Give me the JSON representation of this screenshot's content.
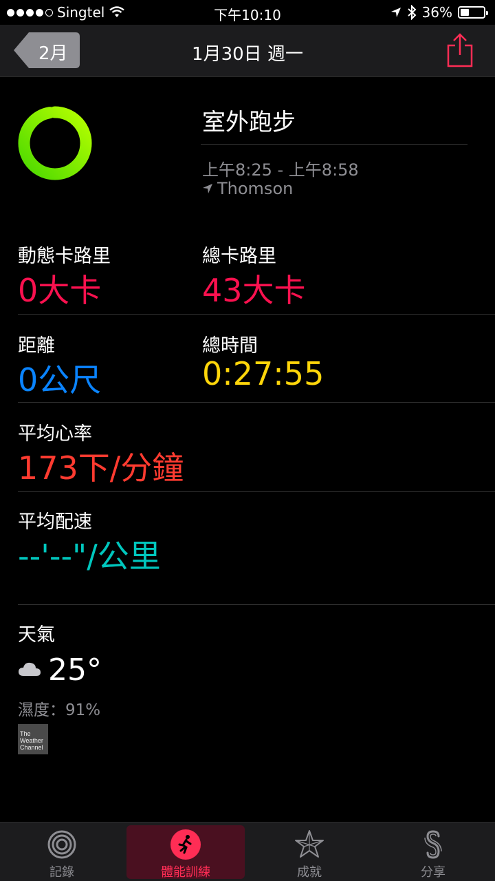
{
  "status_bar": {
    "carrier": "Singtel",
    "time": "下午10:10",
    "battery": "36%",
    "battery_level": 0.36
  },
  "nav": {
    "back_label": "2月",
    "title": "1月30日 週一"
  },
  "workout": {
    "title": "室外跑步",
    "time_range": "上午8:25 - 上午8:58",
    "location": "Thomson",
    "ring_progress": 0.97
  },
  "metrics": {
    "active_calories": {
      "label": "動態卡路里",
      "value": "0大卡"
    },
    "total_calories": {
      "label": "總卡路里",
      "value": "43大卡"
    },
    "distance": {
      "label": "距離",
      "value": "0公尺"
    },
    "total_time": {
      "label": "總時間",
      "value": "0:27:55"
    },
    "avg_heart_rate": {
      "label": "平均心率",
      "value": "173下/分鐘"
    },
    "avg_pace": {
      "label": "平均配速",
      "value": "--'--\"/公里"
    }
  },
  "weather": {
    "title": "天氣",
    "temperature": "25°",
    "humidity": "濕度：91%",
    "provider_logo": "The Weather Channel"
  },
  "tabs": [
    {
      "label": "記錄",
      "icon": "activity-rings-icon",
      "active": false
    },
    {
      "label": "體能訓練",
      "icon": "running-figure-icon",
      "active": true
    },
    {
      "label": "成就",
      "icon": "star-icon",
      "active": false
    },
    {
      "label": "分享",
      "icon": "sharing-icon",
      "active": false
    }
  ],
  "colors": {
    "accent": "#ff2d55",
    "active_calories": "#fa114f",
    "total_calories": "#fa114f",
    "distance": "#0a84ff",
    "total_time": "#ffd60a",
    "heart_rate": "#ff3b30",
    "pace": "#00c7be",
    "ring": "#a6ff00"
  }
}
